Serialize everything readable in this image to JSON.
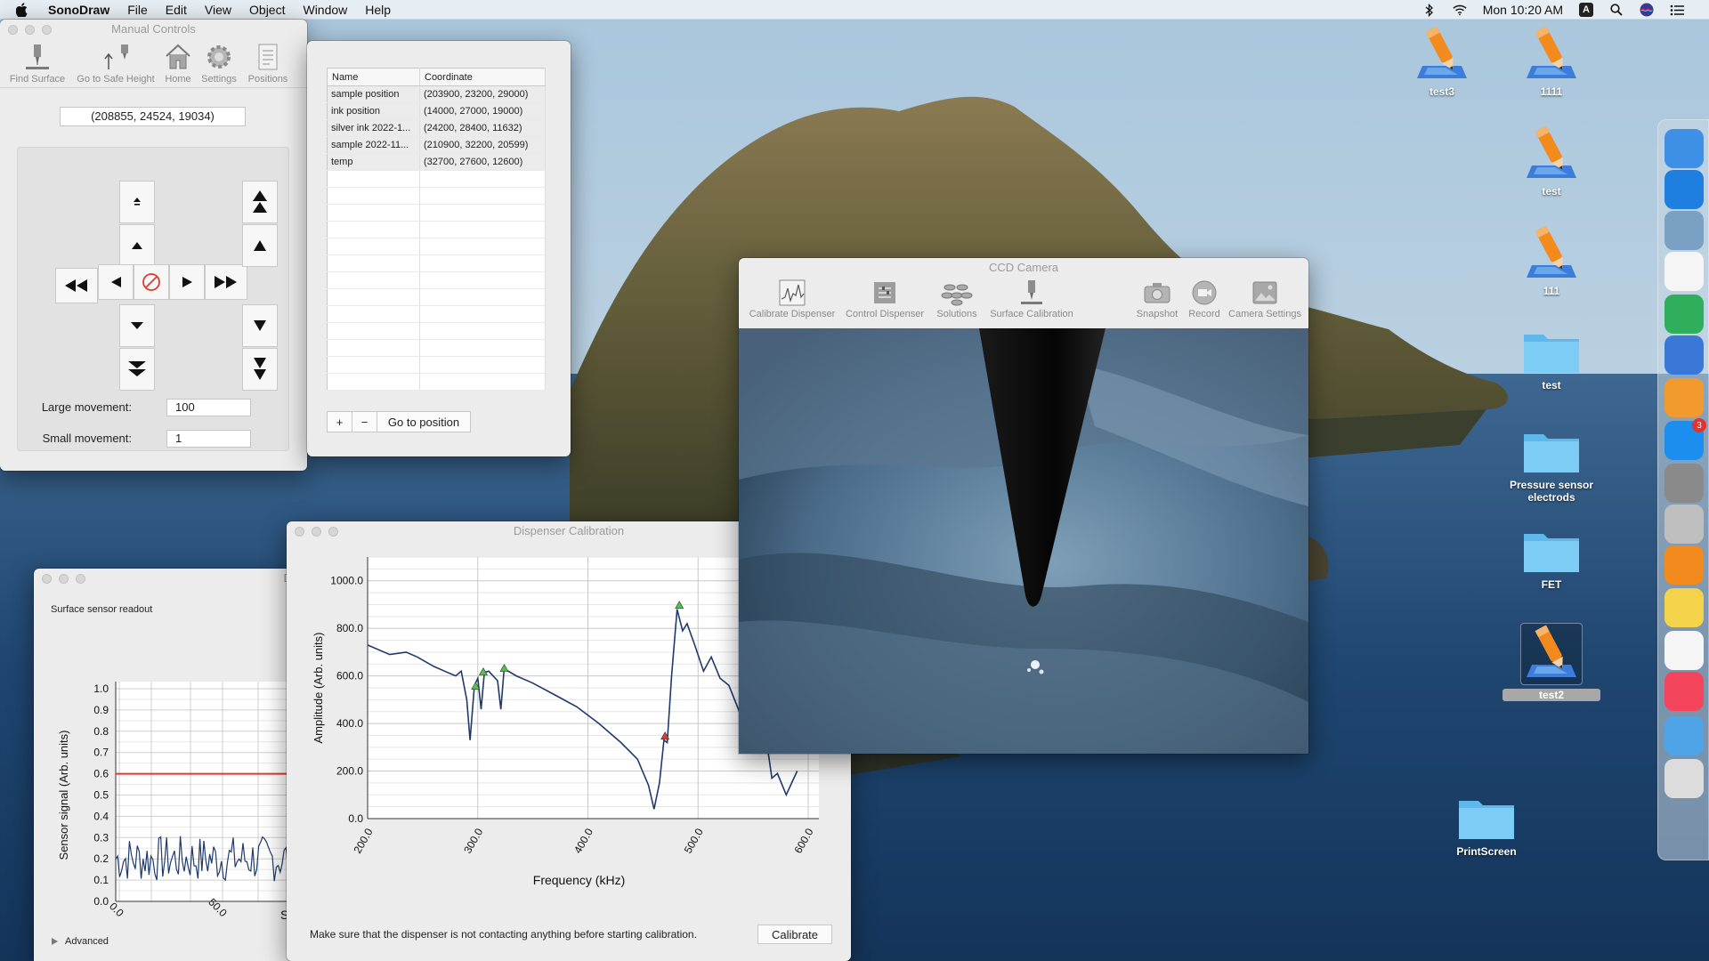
{
  "menubar": {
    "app_name": "SonoDraw",
    "menus": [
      "File",
      "Edit",
      "View",
      "Object",
      "Window",
      "Help"
    ],
    "clock": "Mon 10:20 AM",
    "input_source": "A"
  },
  "manual_controls": {
    "title": "Manual Controls",
    "toolbar": [
      "Find Surface",
      "Go to Safe Height",
      "Home",
      "Settings",
      "Positions"
    ],
    "current_coordinate": "(208855, 24524, 19034)",
    "large_movement_label": "Large movement:",
    "large_movement_value": "100",
    "small_movement_label": "Small movement:",
    "small_movement_value": "1"
  },
  "positions": {
    "headers": [
      "Name",
      "Coordinate"
    ],
    "rows": [
      [
        "sample position",
        "(203900, 23200, 29000)"
      ],
      [
        "ink position",
        "(14000, 27000, 19000)"
      ],
      [
        "silver ink 2022-1...",
        "(24200, 28400, 11632)"
      ],
      [
        "sample 2022-11...",
        "(210900, 32200, 20599)"
      ],
      [
        "temp",
        "(32700, 27600, 12600)"
      ]
    ],
    "add_label": "+",
    "remove_label": "−",
    "go_label": "Go to position"
  },
  "sensor_window": {
    "title_fragment": "Dia",
    "heading": "Surface sensor readout",
    "advanced_label": "Advanced",
    "x_label_fragment": "S",
    "chart": {
      "ylabel": "Sensor signal (Arb. units)",
      "yticks": [
        "1.0",
        "0.9",
        "0.8",
        "0.7",
        "0.6",
        "0.5",
        "0.4",
        "0.3",
        "0.2",
        "0.1",
        "0.0"
      ],
      "xticks": [
        "0.0",
        "50.0"
      ],
      "threshold": 0.6,
      "threshold_color": "#e03a2e"
    }
  },
  "calibration": {
    "title": "Dispenser Calibration",
    "message": "Make sure that the dispenser is not contacting anything before starting calibration.",
    "button_label": "Calibrate",
    "chart": {
      "xlabel": "Frequency (kHz)",
      "ylabel": "Amplitude (Arb. units)",
      "yticks": [
        "1000.0",
        "800.0",
        "600.0",
        "400.0",
        "200.0",
        "0.0"
      ],
      "xticks": [
        "200.0",
        "300.0",
        "400.0",
        "500.0",
        "600.0"
      ],
      "line_color": "#1f3a6b",
      "peaks": [
        {
          "x": 298,
          "y": 555,
          "color": "#4ec34e"
        },
        {
          "x": 305,
          "y": 615,
          "color": "#4ec34e"
        },
        {
          "x": 324,
          "y": 630,
          "color": "#4ec34e"
        },
        {
          "x": 483,
          "y": 895,
          "color": "#4ec34e"
        },
        {
          "x": 470,
          "y": 345,
          "color": "#e03a2e"
        }
      ]
    }
  },
  "camera": {
    "title": "CCD Camera",
    "toolbar_left": [
      "Calibrate Dispenser",
      "Control Dispenser",
      "Solutions",
      "Surface Calibration"
    ],
    "toolbar_right": [
      "Snapshot",
      "Record",
      "Camera Settings"
    ]
  },
  "desktop_icons": [
    {
      "label": "test3",
      "kind": "doc"
    },
    {
      "label": "1111",
      "kind": "doc"
    },
    {
      "label": "test",
      "kind": "doc"
    },
    {
      "label": "111",
      "kind": "doc"
    },
    {
      "label": "test",
      "kind": "folder"
    },
    {
      "label": "Pressure sensor electrods",
      "kind": "folder"
    },
    {
      "label": "FET",
      "kind": "folder"
    },
    {
      "label": "test2",
      "kind": "doc"
    },
    {
      "label": "PrintScreen",
      "kind": "folder"
    }
  ],
  "dock": {
    "items": [
      "finder-icon",
      "safari-icon",
      "preview-icon",
      "reminders-icon",
      "numbers-icon",
      "keynote-icon",
      "pages-icon",
      "app-store-icon",
      "system-preferences-icon",
      "automator-icon",
      "sonodraw-icon",
      "stickies-icon",
      "textedit-icon",
      "music-icon",
      "downloads-icon",
      "trash-icon"
    ],
    "app_store_badge": "3"
  }
}
